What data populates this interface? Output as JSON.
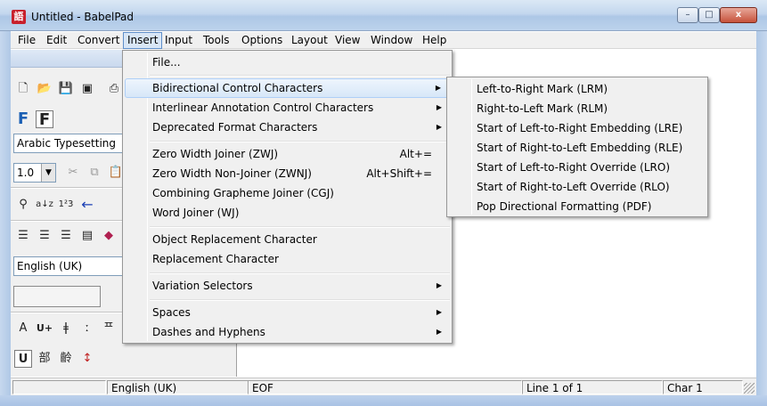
{
  "window": {
    "title": "Untitled - BabelPad",
    "app_icon_glyph": "語"
  },
  "titlebar_buttons": {
    "minimize": "–",
    "maximize": "□",
    "close": "x"
  },
  "menubar": {
    "items": [
      "File",
      "Edit",
      "Convert",
      "Insert",
      "Input",
      "Tools",
      "Options",
      "Layout",
      "View",
      "Window",
      "Help"
    ],
    "open_item": "Insert"
  },
  "toolbar": {
    "font_selector": "Arabic Typesetting",
    "zoom_value": "1.0",
    "language_selector": "English (UK)",
    "icons": {
      "row1": [
        "new-document-icon",
        "open-folder-icon",
        "save-icon",
        "save-all-icon",
        "print-icon"
      ],
      "row2": [
        "font-normal-icon",
        "font-bold-icon"
      ],
      "row3": [
        "cut-icon",
        "copy-icon",
        "paste-icon"
      ],
      "row4": [
        "find-icon",
        "sort-icon",
        "number-icon",
        "arrow-left-icon"
      ],
      "row5": [
        "align-left-icon",
        "align-right-icon",
        "justify-icon",
        "properties-icon",
        "book-icon"
      ],
      "row6": [
        "character-a-icon",
        "unicode-plus-icon",
        "script-glyph-1-icon",
        "script-glyph-2-icon",
        "script-glyph-3-icon"
      ],
      "row7": [
        "underline-u-icon",
        "radical-icon",
        "cjk-glyph-icon",
        "special-glyph-icon"
      ]
    },
    "glyphs": {
      "row6": [
        "A",
        "U+",
        "ǂ",
        "ː",
        "ᄑ"
      ],
      "row7": [
        "U",
        "部",
        "齡",
        "↕"
      ]
    }
  },
  "insert_menu": {
    "items": [
      {
        "label": "File...",
        "shortcut": "",
        "submenu": false
      },
      {
        "label": "Bidirectional Control Characters",
        "shortcut": "",
        "submenu": true,
        "highlighted": true
      },
      {
        "label": "Interlinear Annotation Control Characters",
        "shortcut": "",
        "submenu": true
      },
      {
        "label": "Deprecated Format Characters",
        "shortcut": "",
        "submenu": true
      },
      {
        "label": "Zero Width Joiner (ZWJ)",
        "shortcut": "Alt+=",
        "submenu": false
      },
      {
        "label": "Zero Width Non-Joiner (ZWNJ)",
        "shortcut": "Alt+Shift+=",
        "submenu": false
      },
      {
        "label": "Combining Grapheme Joiner (CGJ)",
        "shortcut": "",
        "submenu": false
      },
      {
        "label": "Word Joiner (WJ)",
        "shortcut": "",
        "submenu": false
      },
      {
        "label": "Object Replacement Character",
        "shortcut": "",
        "submenu": false
      },
      {
        "label": "Replacement Character",
        "shortcut": "",
        "submenu": false
      },
      {
        "label": "Variation Selectors",
        "shortcut": "",
        "submenu": true
      },
      {
        "label": "Spaces",
        "shortcut": "",
        "submenu": true
      },
      {
        "label": "Dashes and Hyphens",
        "shortcut": "",
        "submenu": true
      }
    ],
    "submenu_arrow": "▶"
  },
  "bidi_submenu": {
    "items": [
      "Left-to-Right Mark (LRM)",
      "Right-to-Left Mark (RLM)",
      "Start of Left-to-Right Embedding (LRE)",
      "Start of Right-to-Left Embedding (RLE)",
      "Start of Left-to-Right Override (LRO)",
      "Start of Right-to-Left Override (RLO)",
      "Pop Directional Formatting (PDF)"
    ]
  },
  "statusbar": {
    "cells": [
      "",
      "English (UK)",
      "EOF",
      "Line 1 of 1",
      "Char 1"
    ]
  }
}
